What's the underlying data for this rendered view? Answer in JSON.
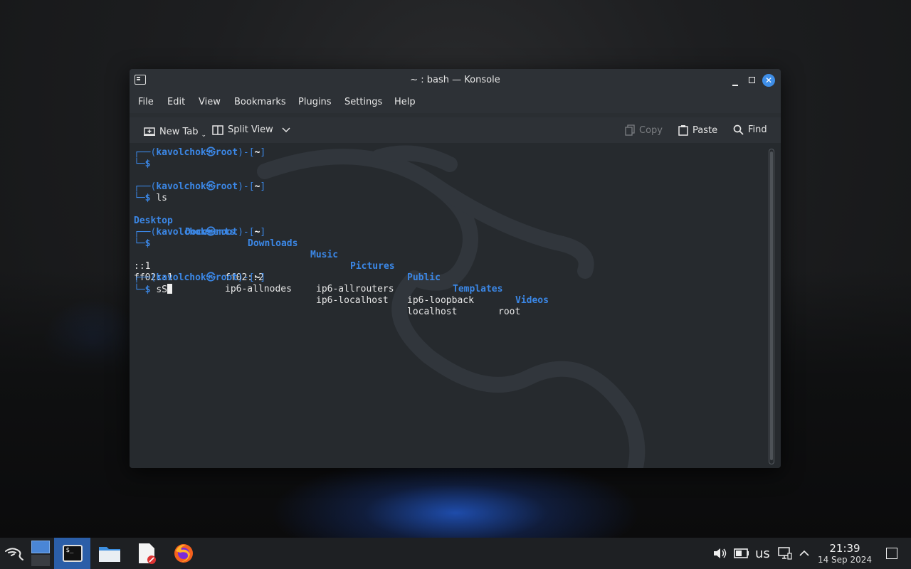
{
  "window": {
    "title": "~ : bash — Konsole"
  },
  "menu": [
    "File",
    "Edit",
    "View",
    "Bookmarks",
    "Plugins",
    "Settings",
    "Help"
  ],
  "toolbar": {
    "new_tab": "New Tab",
    "split_view": "Split View",
    "copy": "Copy",
    "paste": "Paste",
    "find": "Find"
  },
  "terminal": {
    "user": "kavolchok",
    "host": "root",
    "cwd": "~",
    "cmd_ls": "ls",
    "ls_output": [
      "Desktop",
      "Documents",
      "Downloads",
      "Music",
      "Pictures",
      "Public",
      "Templates",
      "Videos"
    ],
    "hosts_output": {
      "row1": [
        "::1",
        "ff02::2",
        "ip6-allrouters",
        "ip6-loopback",
        "root"
      ],
      "row2": [
        "ff02::1",
        "ip6-allnodes",
        "ip6-localhost",
        "localhost"
      ]
    },
    "current_input": "sS"
  },
  "taskbar": {
    "keyboard_layout": "us",
    "time": "21:39",
    "date": "14 Sep 2024"
  },
  "colors": {
    "accent": "#3b87e6",
    "taskbar": "#1e2023",
    "window": "#2a2e32",
    "terminal_bg": "#262a2e"
  }
}
